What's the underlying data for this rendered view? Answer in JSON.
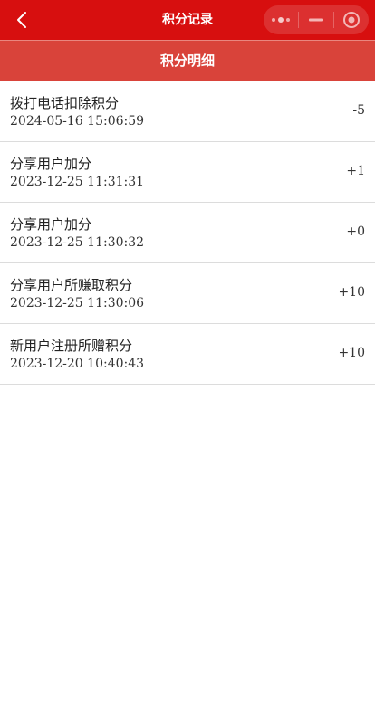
{
  "navbar": {
    "title": "积分记录",
    "back_icon": "chevron-left-icon",
    "capsule": {
      "more_icon": "more-dots-icon",
      "minimize_icon": "minimize-icon",
      "close_icon": "target-circle-icon"
    },
    "background_color": "#d70f0f"
  },
  "section_header": {
    "title": "积分明细",
    "background_color": "#d9433a"
  },
  "records": [
    {
      "description": "拨打电话扣除积分",
      "time": "2024-05-16 15:06:59",
      "points": "-5"
    },
    {
      "description": "分享用户加分",
      "time": "2023-12-25 11:31:31",
      "points": "+1"
    },
    {
      "description": "分享用户加分",
      "time": "2023-12-25 11:30:32",
      "points": "+0"
    },
    {
      "description": "分享用户所赚取积分",
      "time": "2023-12-25 11:30:06",
      "points": "+10"
    },
    {
      "description": "新用户注册所赠积分",
      "time": "2023-12-20 10:40:43",
      "points": "+10"
    }
  ]
}
